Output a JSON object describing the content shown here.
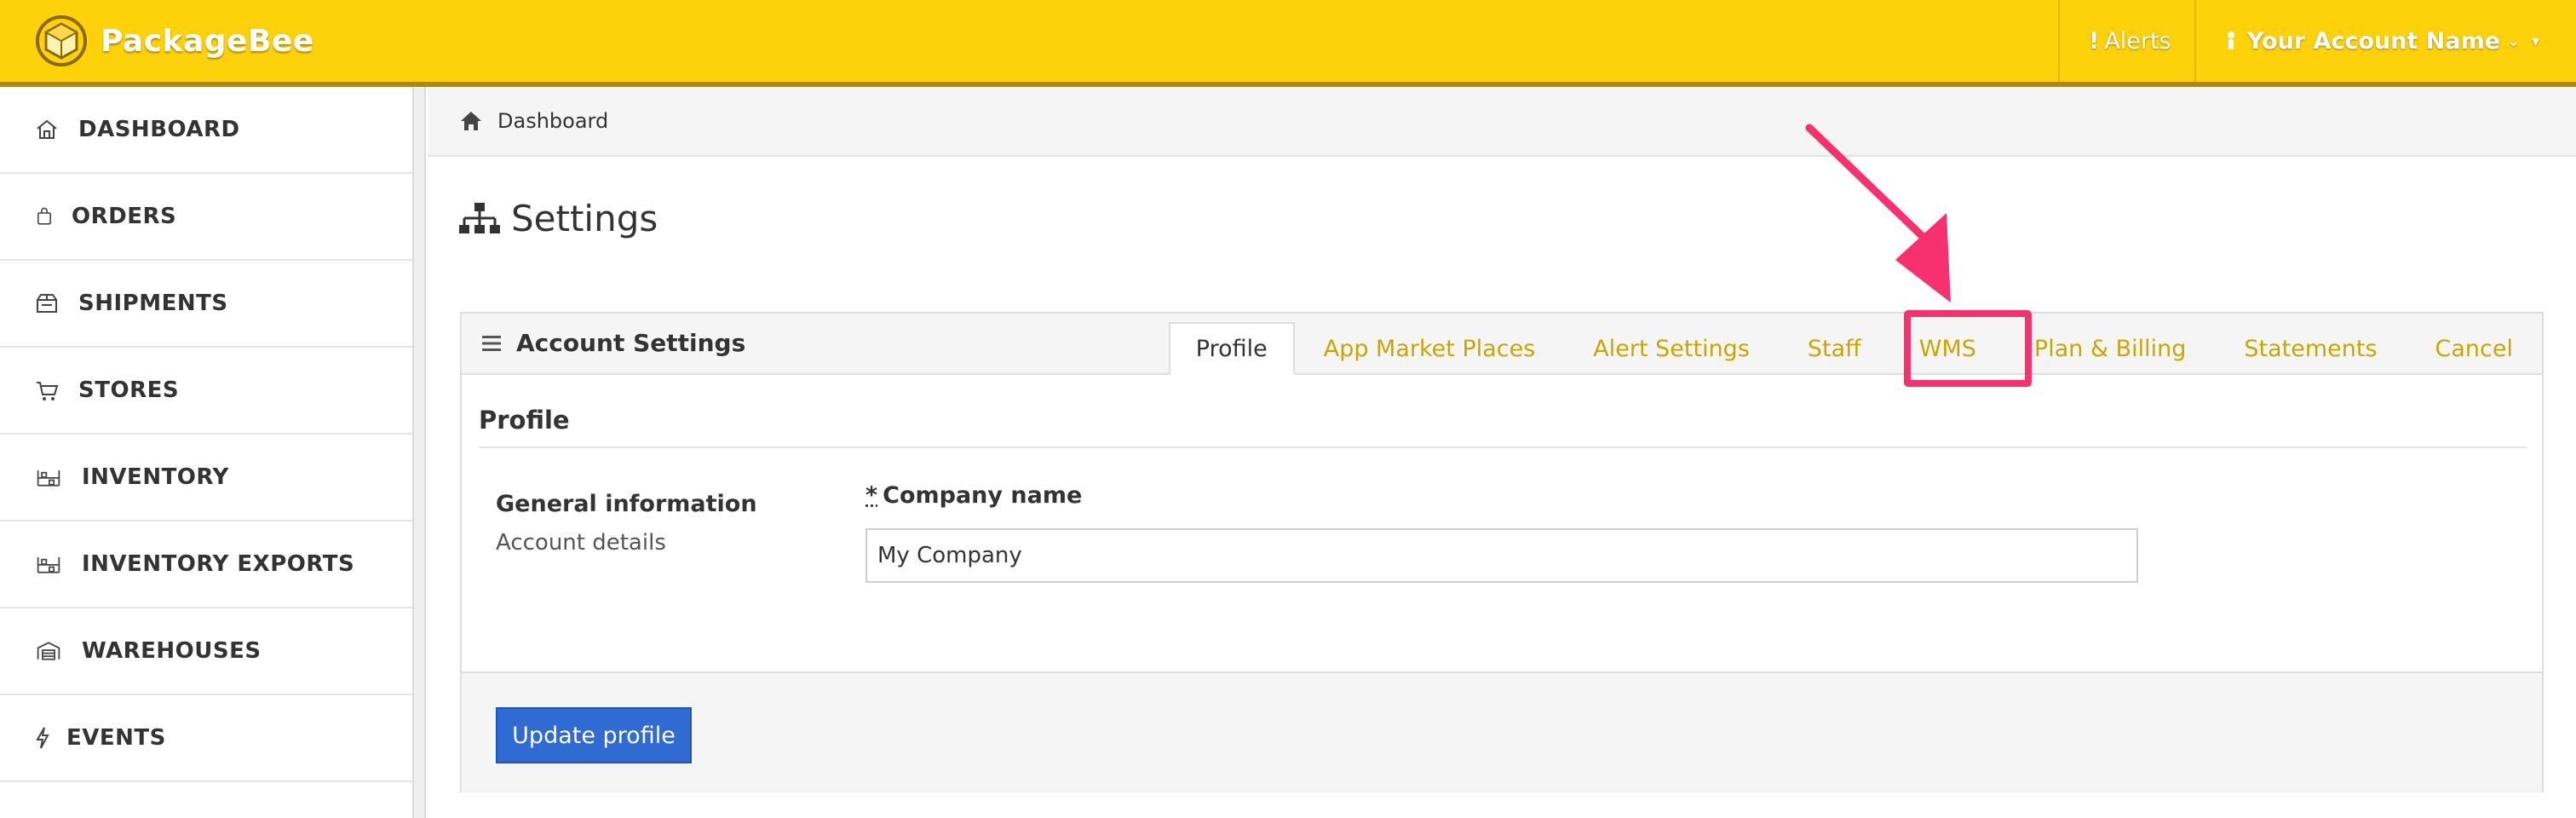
{
  "app": {
    "brand_name": "PackageBee",
    "accent_color": "#fed20b",
    "link_color": "#c9a700",
    "primary_button_color": "#2f6bd3",
    "highlight_color": "#f7306f"
  },
  "topnav": {
    "alerts_label": "Alerts",
    "account_label": "Your Account Name"
  },
  "sidebar": {
    "items": [
      {
        "label": "DASHBOARD",
        "icon": "home-icon"
      },
      {
        "label": "ORDERS",
        "icon": "shopping-bag-icon"
      },
      {
        "label": "SHIPMENTS",
        "icon": "box-icon"
      },
      {
        "label": "STORES",
        "icon": "cart-icon"
      },
      {
        "label": "INVENTORY",
        "icon": "warehouse-shelf-icon"
      },
      {
        "label": "INVENTORY EXPORTS",
        "icon": "warehouse-shelf-icon"
      },
      {
        "label": "WAREHOUSES",
        "icon": "warehouse-icon"
      },
      {
        "label": "EVENTS",
        "icon": "bolt-icon"
      }
    ]
  },
  "breadcrumb": {
    "home": "Dashboard"
  },
  "page": {
    "title": "Settings"
  },
  "panel": {
    "title": "Account Settings",
    "tabs": [
      {
        "label": "Profile",
        "active": true
      },
      {
        "label": "App Market Places"
      },
      {
        "label": "Alert Settings"
      },
      {
        "label": "Staff"
      },
      {
        "label": "WMS",
        "highlighted": true
      },
      {
        "label": "Plan & Billing"
      },
      {
        "label": "Statements"
      },
      {
        "label": "Cancel"
      }
    ],
    "section_title": "Profile",
    "general_info": "General information",
    "account_details": "Account details",
    "company_label_required": "*",
    "company_label": "Company name",
    "company_value": "My Company",
    "update_button": "Update profile"
  }
}
